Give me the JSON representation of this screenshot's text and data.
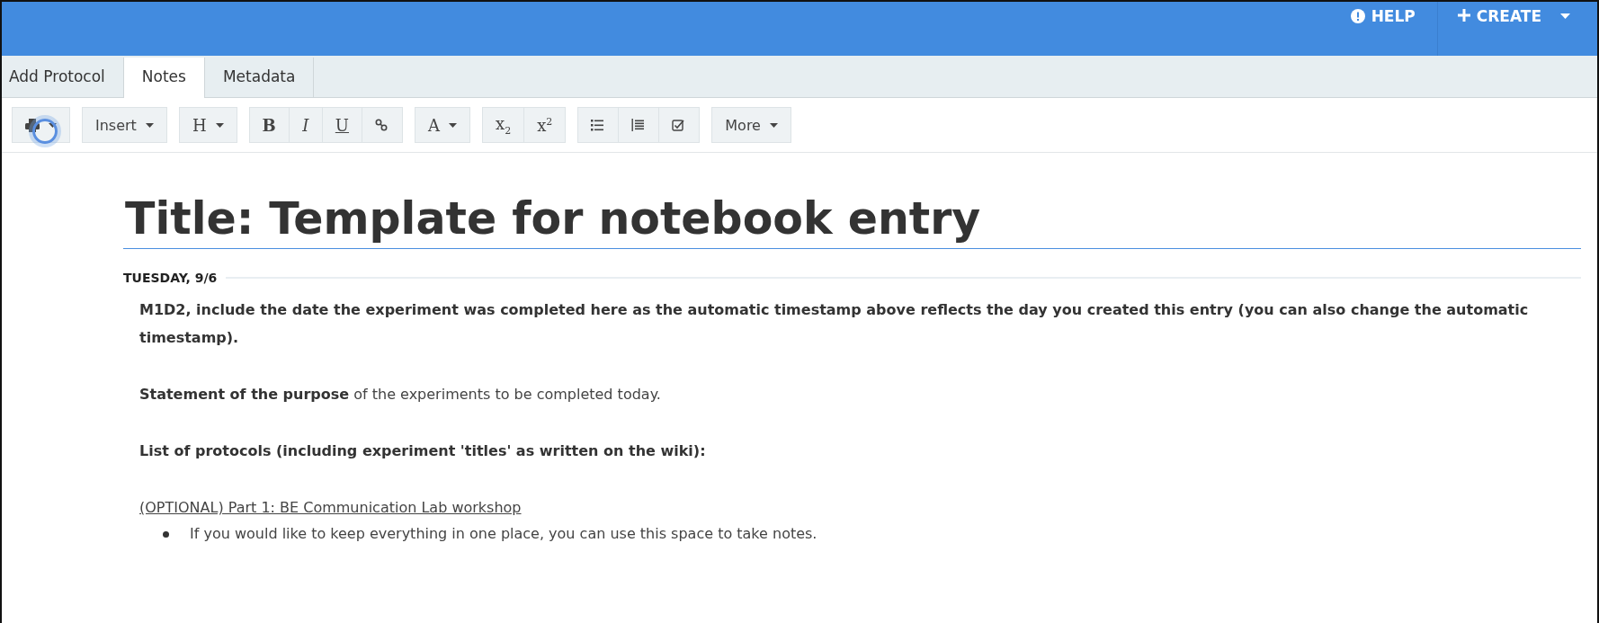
{
  "top_bar": {
    "help": "HELP",
    "create": "CREATE"
  },
  "tabs": [
    {
      "label": "Add Protocol",
      "selected": false
    },
    {
      "label": "Notes",
      "selected": true
    },
    {
      "label": "Metadata",
      "selected": false
    }
  ],
  "toolbar": [
    [
      {
        "kind": "print-menu"
      }
    ],
    [
      {
        "kind": "text-menu",
        "label": "Insert"
      }
    ],
    [
      {
        "kind": "serif-menu",
        "label": "H"
      }
    ],
    [
      {
        "kind": "serif-bold",
        "label": "B"
      },
      {
        "kind": "serif-italic",
        "label": "I"
      },
      {
        "kind": "serif-underline",
        "label": "U"
      },
      {
        "kind": "link"
      }
    ],
    [
      {
        "kind": "serif-menu",
        "label": "A"
      }
    ],
    [
      {
        "kind": "serif",
        "label": "x$_{2}$"
      },
      {
        "kind": "serif",
        "label": "x$^{2}$"
      }
    ],
    [
      {
        "kind": "bullet-list"
      },
      {
        "kind": "numbered-list"
      },
      {
        "kind": "checklist"
      }
    ],
    [
      {
        "kind": "text-menu",
        "label": "More"
      }
    ]
  ],
  "document": {
    "title": "Title: Template for notebook entry",
    "date": "TUESDAY, 9/6",
    "blocks": [
      {
        "kind": "bold",
        "text": "M1D2, include the date the experiment was completed here as the automatic timestamp above reflects the day you created this entry (you can also change the automatic timestamp)."
      },
      {
        "kind": "plain",
        "text": "**Statement of the purpose** of the experiments to be completed today."
      },
      {
        "kind": "bold",
        "text": "List of protocols (including experiment 'titles' as written on the wiki):"
      },
      {
        "kind": "underline",
        "text": "(OPTIONAL) Part 1: BE Communication Lab workshop"
      },
      {
        "kind": "bullet",
        "text": "If you would like to keep everything in one place, you can use this space to take notes."
      }
    ]
  }
}
